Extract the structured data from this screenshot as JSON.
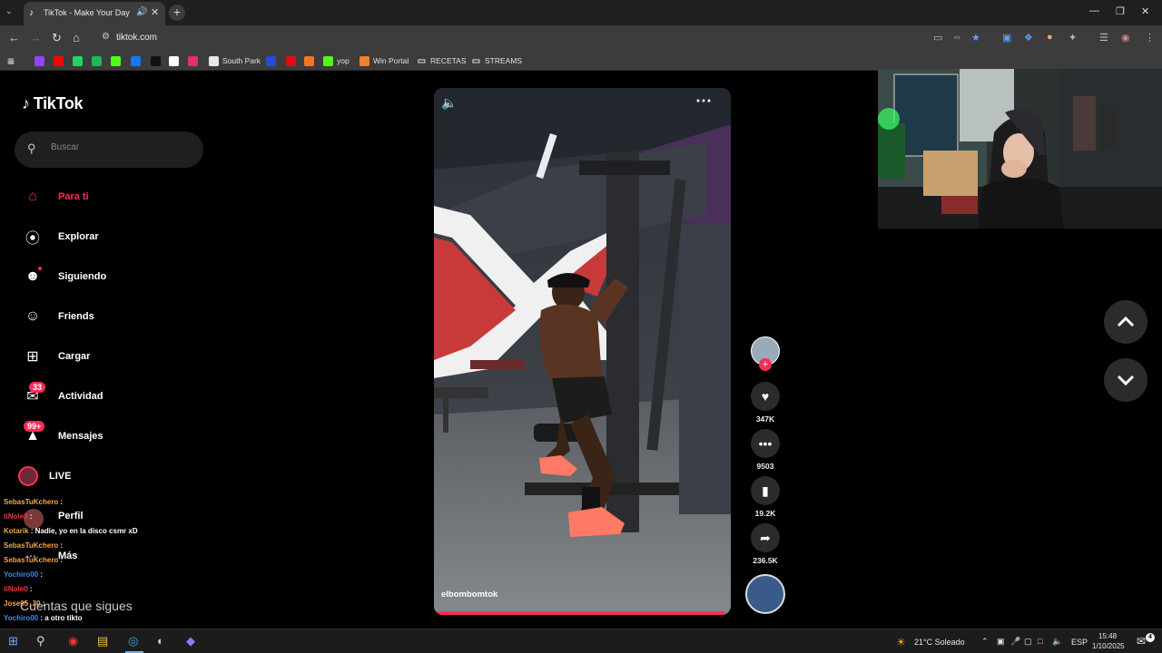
{
  "browser": {
    "tab_title": "TikTok - Make Your Day",
    "url": "tiktok.com",
    "bookmarks": [
      {
        "label": "",
        "icon": "twitch-icon",
        "color": "#9146ff"
      },
      {
        "label": "",
        "icon": "youtube-icon",
        "color": "#ff0000"
      },
      {
        "label": "",
        "icon": "whatsapp-icon",
        "color": "#25d366"
      },
      {
        "label": "",
        "icon": "spotify-icon",
        "color": "#1db954"
      },
      {
        "label": "",
        "icon": "kick-icon",
        "color": "#53fc18"
      },
      {
        "label": "",
        "icon": "facebook-icon",
        "color": "#1877f2"
      },
      {
        "label": "",
        "icon": "tiktok-icon",
        "color": "#111111"
      },
      {
        "label": "",
        "icon": "amazon-icon",
        "color": "#ffffff"
      },
      {
        "label": "",
        "icon": "instagram-icon",
        "color": "#e1306c"
      },
      {
        "label": "South Park",
        "icon": "southpark-icon",
        "color": "#e8e8e8"
      },
      {
        "label": "",
        "icon": "m-icon",
        "color": "#2b4ad6"
      },
      {
        "label": "",
        "icon": "netflix-icon",
        "color": "#e50914"
      },
      {
        "label": "",
        "icon": "crunchyroll-icon",
        "color": "#f47521"
      },
      {
        "label": "yop",
        "icon": "kick-icon",
        "color": "#53fc18"
      },
      {
        "label": "Win Portal",
        "icon": "fire-icon",
        "color": "#f0812a"
      },
      {
        "label": "RECETAS",
        "icon": "folder-icon",
        "color": "#3c3c3c"
      },
      {
        "label": "STREAMS",
        "icon": "folder-icon",
        "color": "#3c3c3c"
      }
    ]
  },
  "sidebar": {
    "logo": "TikTok",
    "search_placeholder": "Buscar",
    "nav": [
      {
        "label": "Para ti",
        "icon": "home-icon",
        "active": true
      },
      {
        "label": "Explorar",
        "icon": "compass-icon"
      },
      {
        "label": "Siguiendo",
        "icon": "following-icon"
      },
      {
        "label": "Friends",
        "icon": "friends-icon"
      },
      {
        "label": "Cargar",
        "icon": "upload-icon"
      },
      {
        "label": "Actividad",
        "icon": "activity-icon",
        "badge": "33"
      },
      {
        "label": "Mensajes",
        "icon": "messages-icon",
        "badge": "99+"
      },
      {
        "label": "LIVE",
        "icon": "live-icon"
      }
    ],
    "perfil": "Perfil",
    "mas": "Más",
    "following_header": "Cuentas que sigues"
  },
  "chat": [
    {
      "user": "SebasTuKchero",
      "text": ":"
    },
    {
      "user": "tiNole0",
      "text": ":"
    },
    {
      "user": "Kotarik",
      "text": ": Nadie, yo en la disco csmr xD"
    },
    {
      "user": "SebasTuKchero",
      "text": ":"
    },
    {
      "user": "SebasTuKchero",
      "text": ":"
    },
    {
      "user": "Yochiro00",
      "text": ":"
    },
    {
      "user": "tiNole0",
      "text": ":"
    },
    {
      "user": "Jose05_30",
      "text": ":"
    },
    {
      "user": "Yochiro00",
      "text": ": a otro tikto"
    }
  ],
  "video": {
    "author": "elbombomtok",
    "progress": 0.98
  },
  "actions": {
    "likes": "347K",
    "comments": "9503",
    "saves": "19.2K",
    "shares": "236.5K"
  },
  "taskbar": {
    "weather": "21°C  Soleado",
    "lang": "ESP",
    "time": "15:48",
    "date": "1/10/2025"
  }
}
